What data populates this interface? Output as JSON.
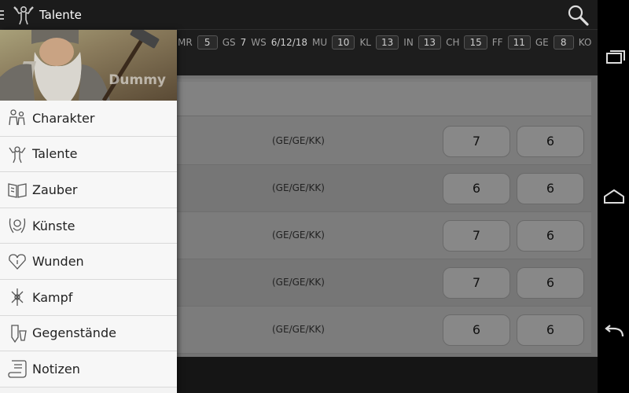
{
  "actionbar": {
    "title": "Talente",
    "icon": "strongman-icon",
    "search_icon": "magnifier-icon"
  },
  "attributes": [
    {
      "label": "MR",
      "value": "5",
      "boxed": true
    },
    {
      "label": "GS",
      "value": "7",
      "boxed": false
    },
    {
      "label": "WS",
      "value": "6/12/18",
      "boxed": false
    },
    {
      "label": "MU",
      "value": "10",
      "boxed": true
    },
    {
      "label": "KL",
      "value": "13",
      "boxed": true
    },
    {
      "label": "IN",
      "value": "13",
      "boxed": true
    },
    {
      "label": "CH",
      "value": "15",
      "boxed": true
    },
    {
      "label": "FF",
      "value": "11",
      "boxed": true
    },
    {
      "label": "GE",
      "value": "8",
      "boxed": true
    },
    {
      "label": "KO",
      "value": "",
      "boxed": false
    }
  ],
  "drawer": {
    "character_name": "Dummy",
    "items": [
      {
        "label": "Charakter",
        "icon": "character-icon"
      },
      {
        "label": "Talente",
        "icon": "strongman-icon"
      },
      {
        "label": "Zauber",
        "icon": "spellbook-icon"
      },
      {
        "label": "Künste",
        "icon": "arts-icon"
      },
      {
        "label": "Wunden",
        "icon": "wounds-heart-icon"
      },
      {
        "label": "Kampf",
        "icon": "combat-icon"
      },
      {
        "label": "Gegenstände",
        "icon": "items-icon"
      },
      {
        "label": "Notizen",
        "icon": "scroll-icon"
      }
    ]
  },
  "talents": [
    {
      "probe": "(GE/GE/KK)",
      "value1": "7",
      "value2": "6"
    },
    {
      "probe": "(GE/GE/KK)",
      "value1": "6",
      "value2": "6"
    },
    {
      "probe": "(GE/GE/KK)",
      "value1": "7",
      "value2": "6"
    },
    {
      "probe": "(GE/GE/KK)",
      "value1": "7",
      "value2": "6"
    },
    {
      "probe": "(GE/GE/KK)",
      "value1": "6",
      "value2": "6"
    }
  ],
  "colors": {
    "actionbar": "#1b1b1b",
    "drawer": "#f3f3f3",
    "content_dim": "#7c7c7c"
  }
}
